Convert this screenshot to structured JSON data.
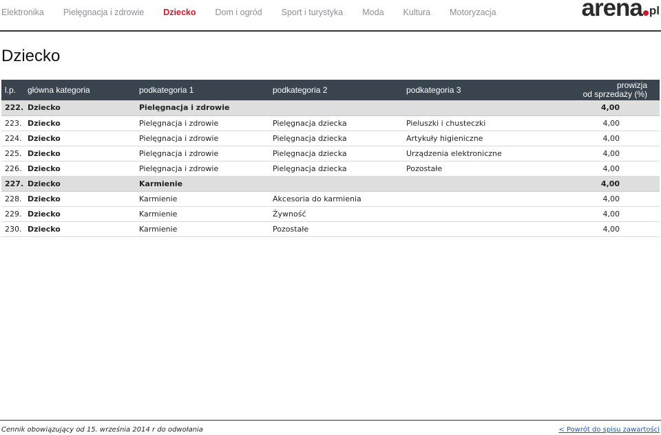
{
  "nav": {
    "items": [
      {
        "label": "Elektronika",
        "active": false
      },
      {
        "label": "Pielęgnacja i zdrowie",
        "active": false
      },
      {
        "label": "Dziecko",
        "active": true
      },
      {
        "label": "Dom i ogród",
        "active": false
      },
      {
        "label": "Sport i turystyka",
        "active": false
      },
      {
        "label": "Moda",
        "active": false
      },
      {
        "label": "Kultura",
        "active": false
      },
      {
        "label": "Motoryzacja",
        "active": false
      }
    ]
  },
  "logo": {
    "main": "arena",
    "suffix": "pl"
  },
  "page": {
    "title": "Dziecko"
  },
  "table": {
    "headers": {
      "lp": "l.p.",
      "main": "główna kategoria",
      "sub1": "podkategoria 1",
      "sub2": "podkategoria 2",
      "sub3": "podkategoria 3",
      "commission_line1": "prowizja",
      "commission_line2": "od sprzedaży (%)"
    },
    "rows": [
      {
        "lp": "222.",
        "main": "Dziecko",
        "sub1": "Pielęgnacja i zdrowie",
        "sub2": "",
        "sub3": "",
        "commission": "4,00",
        "group": true
      },
      {
        "lp": "223.",
        "main": "Dziecko",
        "sub1": "Pielęgnacja i zdrowie",
        "sub2": "Pielęgnacja dziecka",
        "sub3": "Pieluszki i chusteczki",
        "commission": "4,00",
        "group": false
      },
      {
        "lp": "224.",
        "main": "Dziecko",
        "sub1": "Pielęgnacja i zdrowie",
        "sub2": "Pielęgnacja dziecka",
        "sub3": "Artykuły higieniczne",
        "commission": "4,00",
        "group": false
      },
      {
        "lp": "225.",
        "main": "Dziecko",
        "sub1": "Pielęgnacja i zdrowie",
        "sub2": "Pielęgnacja dziecka",
        "sub3": "Urządzenia elektroniczne",
        "commission": "4,00",
        "group": false
      },
      {
        "lp": "226.",
        "main": "Dziecko",
        "sub1": "Pielęgnacja i zdrowie",
        "sub2": "Pielęgnacja dziecka",
        "sub3": "Pozostałe",
        "commission": "4,00",
        "group": false
      },
      {
        "lp": "227.",
        "main": "Dziecko",
        "sub1": "Karmienie",
        "sub2": "",
        "sub3": "",
        "commission": "4,00",
        "group": true
      },
      {
        "lp": "228.",
        "main": "Dziecko",
        "sub1": "Karmienie",
        "sub2": "Akcesoria do karmienia",
        "sub3": "",
        "commission": "4,00",
        "group": false
      },
      {
        "lp": "229.",
        "main": "Dziecko",
        "sub1": "Karmienie",
        "sub2": "Żywność",
        "sub3": "",
        "commission": "4,00",
        "group": false
      },
      {
        "lp": "230.",
        "main": "Dziecko",
        "sub1": "Karmienie",
        "sub2": "Pozostałe",
        "sub3": "",
        "commission": "4,00",
        "group": false
      }
    ]
  },
  "footer": {
    "note": "Cennik obowiązujący od 15. września 2014 r do odwołania",
    "back_link": "< Powrót do spisu zawartości"
  }
}
